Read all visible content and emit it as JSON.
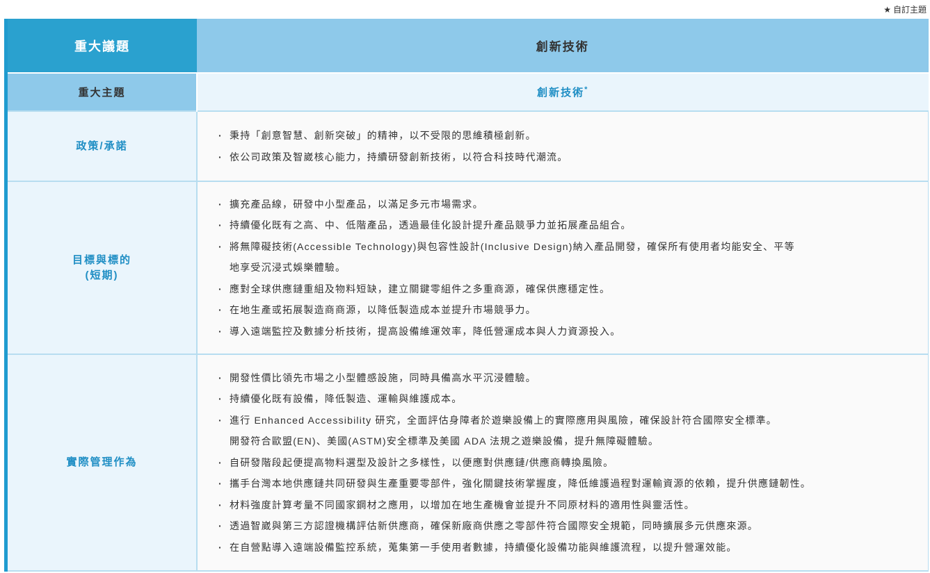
{
  "legend": {
    "star": "★",
    "text": "自訂主題"
  },
  "header": {
    "left": "重大議題",
    "right": "創新技術"
  },
  "subheader": {
    "left": "重大主題",
    "right": "創新技術",
    "right_mark": "*"
  },
  "rows": {
    "policy": {
      "label": "政策/承諾",
      "items": [
        "秉持「創意智慧、創新突破」的精神，以不受限的思維積極創新。",
        "依公司政策及智崴核心能力，持續研發創新技術，以符合科技時代潮流。"
      ]
    },
    "goals": {
      "label_line1": "目標與標的",
      "label_line2": "(短期)",
      "items": [
        "擴充產品線，研發中小型產品，以滿足多元市場需求。",
        "持續優化既有之高、中、低階產品，透過最佳化設計提升產品競爭力並拓展產品組合。",
        "將無障礙技術(Accessible Technology)與包容性設計(Inclusive Design)納入產品開發，確保所有使用者均能安全、平等",
        "地享受沉浸式娛樂體驗。",
        "應對全球供應鏈重組及物料短缺，建立關鍵零組件之多重商源，確保供應穩定性。",
        "在地生產或拓展製造商商源，以降低製造成本並提升市場競爭力。",
        "導入遠端監控及數據分析技術，提高設備維運效率，降低營運成本與人力資源投入。"
      ]
    },
    "practice": {
      "label": "實際管理作為",
      "items": [
        "開發性價比領先市場之小型體感設施，同時具備高水平沉浸體驗。",
        "持續優化既有設備，降低製造、運輸與維護成本。",
        "進行 Enhanced Accessibility 研究，全面評估身障者於遊樂設備上的實際應用與風險，確保設計符合國際安全標準。",
        "開發符合歐盟(EN)、美國(ASTM)安全標準及美國 ADA 法規之遊樂設備，提升無障礙體驗。",
        "自研發階段起便提高物料選型及設計之多樣性，以便應對供應鏈/供應商轉換風險。",
        "攜手台灣本地供應鏈共同研發與生產重要零部件，強化關鍵技術掌握度，降低維護過程對運輸資源的依賴，提升供應鏈韌性。",
        "材料強度計算考量不同國家鋼材之應用，以增加在地生產機會並提升不同原材料的適用性與靈活性。",
        "透過智崴與第三方認證機構評估新供應商，確保新廠商供應之零部件符合國際安全規範，同時擴展多元供應來源。",
        "在自營點導入遠端設備監控系統，蒐集第一手使用者數據，持續優化設備功能與維護流程，以提升營運效能。"
      ]
    }
  }
}
